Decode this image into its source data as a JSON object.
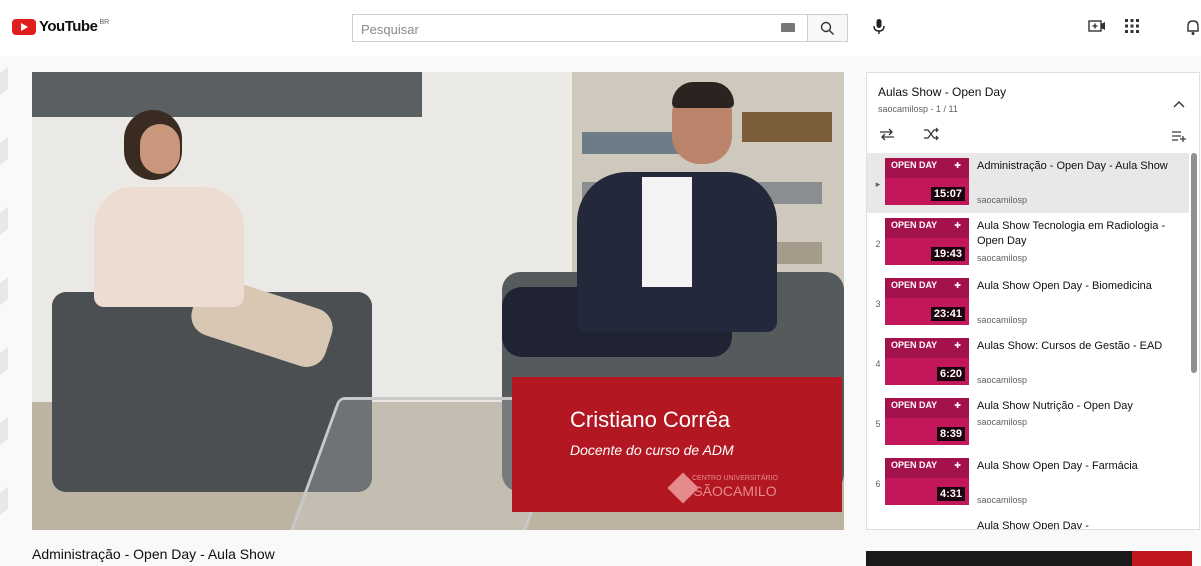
{
  "header": {
    "logo_text": "YouTube",
    "logo_region": "BR",
    "search_placeholder": "Pesquisar",
    "icons": [
      "keyboard-icon",
      "search-icon",
      "mic-icon",
      "create-video-icon",
      "apps-icon",
      "notifications-icon"
    ]
  },
  "video": {
    "lower_third_name": "Cristiano Corrêa",
    "lower_third_role": "Docente do curso de ADM",
    "lower_third_logo_top": "CENTRO UNIVERSITÁRIO",
    "lower_third_logo_name": "SÃOCAMILO",
    "title": "Administração - Open Day - Aula Show"
  },
  "playlist": {
    "title": "Aulas Show  - Open Day",
    "subtitle": "saocamilosp - 1 / 11",
    "items": [
      {
        "index": "▸",
        "title": "Administração - Open Day - Aula Show",
        "channel": "saocamilosp",
        "duration": "15:07",
        "active": true
      },
      {
        "index": "2",
        "title": "Aula Show Tecnologia em Radiologia - Open Day",
        "channel": "saocamilosp",
        "duration": "19:43",
        "active": false
      },
      {
        "index": "3",
        "title": "Aula Show Open Day - Biomedicina",
        "channel": "saocamilosp",
        "duration": "23:41",
        "active": false
      },
      {
        "index": "4",
        "title": "Aulas Show: Cursos de Gestão - EAD",
        "channel": "saocamilosp",
        "duration": "6:20",
        "active": false
      },
      {
        "index": "5",
        "title": "Aula Show Nutrição - Open Day",
        "channel": "saocamilosp",
        "duration": "8:39",
        "active": false
      },
      {
        "index": "6",
        "title": "Aula Show Open Day - Farmácia",
        "channel": "saocamilosp",
        "duration": "4:31",
        "active": false
      },
      {
        "index": "",
        "title": "Aula Show Open Day -",
        "channel": "",
        "duration": "",
        "active": false
      }
    ],
    "thumb_label": "OPEN DAY"
  },
  "colors": {
    "brand_red": "#e01e1e",
    "lower_third_red": "#b31822",
    "thumb_magenta": "#c2185b"
  }
}
